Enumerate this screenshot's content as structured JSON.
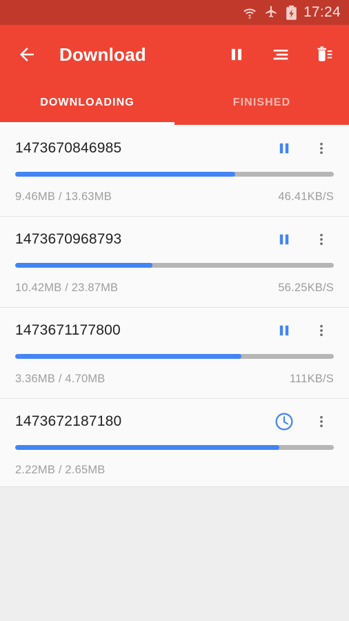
{
  "status_bar": {
    "icons": [
      "wifi-data-icon",
      "airplane-mode-icon",
      "battery-charging-icon"
    ],
    "time": "17:24",
    "background_color": "#c1392b",
    "text_color": "#f6e3e0"
  },
  "appbar": {
    "background_color": "#ef4434",
    "back_icon": "back-arrow-icon",
    "title": "Download",
    "actions": [
      {
        "name": "pause-all-button",
        "icon": "pause-icon"
      },
      {
        "name": "sort-button",
        "icon": "sort-lines-icon"
      },
      {
        "name": "delete-button",
        "icon": "delete-list-icon"
      }
    ]
  },
  "tabs": {
    "items": [
      {
        "label": "DOWNLOADING",
        "active": true
      },
      {
        "label": "FINISHED",
        "active": false
      }
    ],
    "indicator_color": "#ffffff"
  },
  "accent_color": "#4285f4",
  "track_color": "#b6b6b6",
  "downloads": [
    {
      "name": "1473670846985",
      "progress": 69,
      "size": "9.46MB / 13.63MB",
      "speed": "46.41KB/S",
      "state_icon": "pause-icon",
      "menu_icon": "more-vertical-icon"
    },
    {
      "name": "1473670968793",
      "progress": 43,
      "size": "10.42MB / 23.87MB",
      "speed": "56.25KB/S",
      "state_icon": "pause-icon",
      "menu_icon": "more-vertical-icon"
    },
    {
      "name": "1473671177800",
      "progress": 71,
      "size": "3.36MB / 4.70MB",
      "speed": "111KB/S",
      "state_icon": "pause-icon",
      "menu_icon": "more-vertical-icon"
    },
    {
      "name": "1473672187180",
      "progress": 83,
      "size": "2.22MB / 2.65MB",
      "speed": "",
      "state_icon": "pending-clock-icon",
      "menu_icon": "more-vertical-icon"
    }
  ]
}
